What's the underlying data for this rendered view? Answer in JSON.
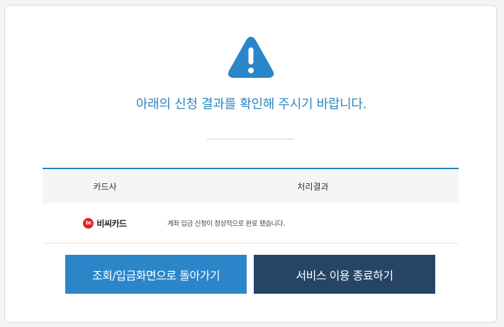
{
  "message": {
    "headline": "아래의 신청 결과를 확인해 주시기 바랍니다."
  },
  "table": {
    "headers": {
      "card_company": "카드사",
      "result": "처리결과"
    },
    "rows": [
      {
        "card_logo_text": "bc",
        "card_name": "비씨카드",
        "result": "계좌 입금 신청이 정상적으로 완료 됐습니다."
      }
    ]
  },
  "buttons": {
    "back_label": "조회/입금화면으로 돌아가기",
    "exit_label": "서비스 이용 종료하기"
  },
  "colors": {
    "accent": "#2b86c9",
    "dark": "#264466",
    "warning_icon": "#2b86c9"
  },
  "icons": {
    "warning": "warning-icon"
  }
}
